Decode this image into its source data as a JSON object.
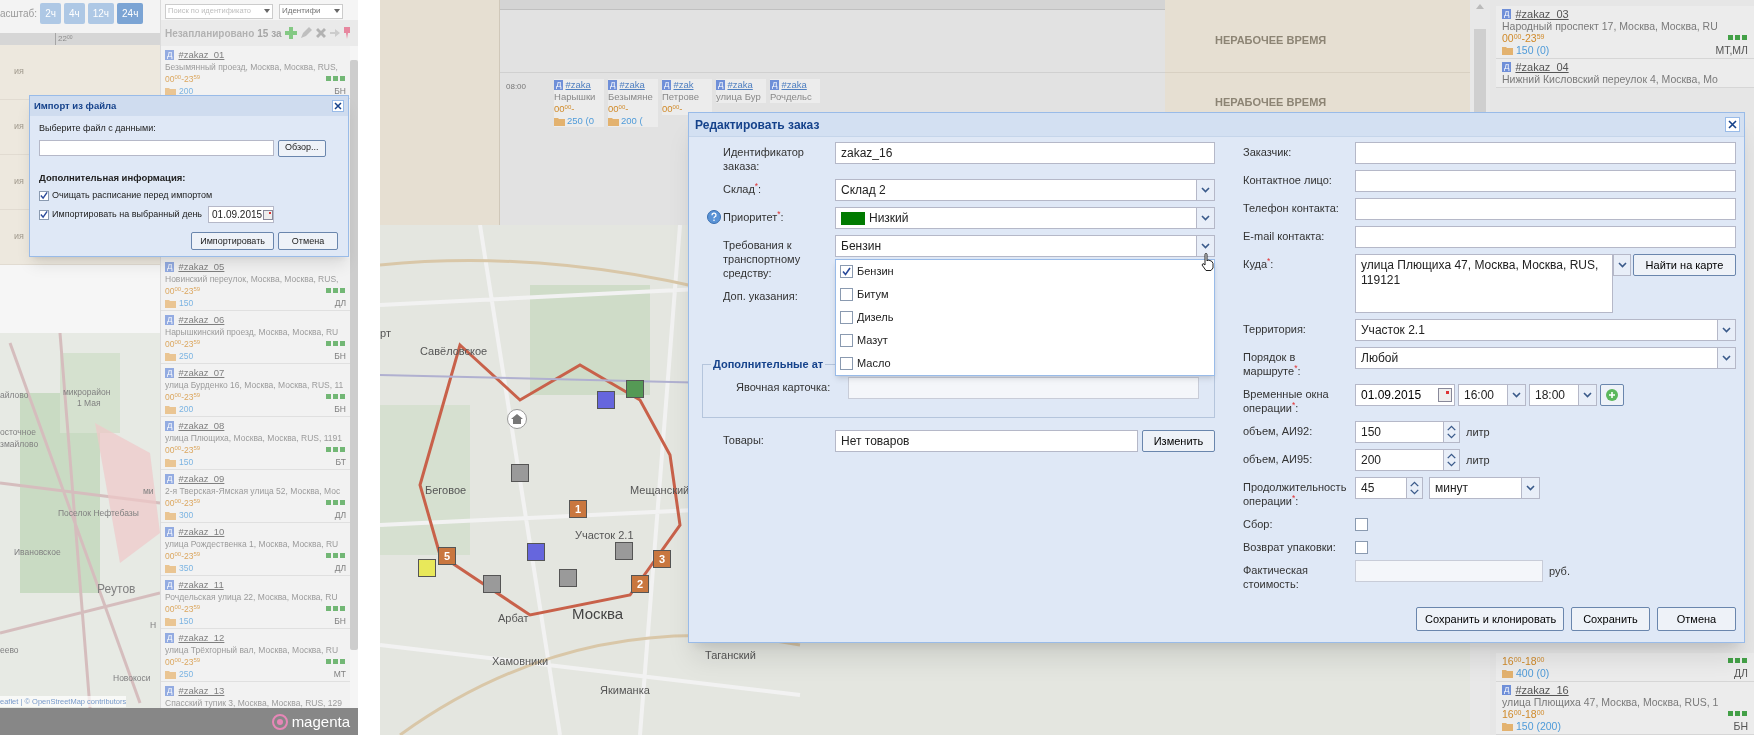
{
  "left_screen": {
    "scale_label": "асштаб:",
    "scale_options": [
      {
        "label": "2ч",
        "selected": false
      },
      {
        "label": "4ч",
        "selected": false
      },
      {
        "label": "12ч",
        "selected": false
      },
      {
        "label": "24ч",
        "selected": true
      }
    ],
    "search": {
      "placeholder": "Поиск по идентификато"
    },
    "search_by": "Идентифи",
    "timeline_hour": "22$^{00}$",
    "nonworking_rows": [
      "ия",
      "ия",
      "ия",
      "ия"
    ],
    "unplanned": {
      "label": "Незапланировано",
      "count": "15 за"
    },
    "orders_top": [
      {
        "badge": "Д",
        "id": "#zakaz_01",
        "address": "Безымянный проезд, Москва, Москва, RUS,",
        "time": "00$^{00}$-23$^{59}$",
        "volume": "200",
        "tag": "БН"
      }
    ],
    "orders_bottom": [
      {
        "badge": "Д",
        "id": "#zakaz_05",
        "address": "Новинский переулок, Москва, Москва, RUS,",
        "time": "00$^{00}$-23$^{59}$",
        "volume": "150",
        "tag": "ДЛ"
      },
      {
        "badge": "Д",
        "id": "#zakaz_06",
        "address": "Нарышкинский проезд, Москва, Москва, RU",
        "time": "00$^{00}$-23$^{59}$",
        "volume": "250",
        "tag": "БН"
      },
      {
        "badge": "Д",
        "id": "#zakaz_07",
        "address": "улица Бурденко 16, Москва, Москва, RUS, 11",
        "time": "00$^{00}$-23$^{59}$",
        "volume": "200",
        "tag": "БН"
      },
      {
        "badge": "Д",
        "id": "#zakaz_08",
        "address": "улица Плющиха, Москва, Москва, RUS, 1191",
        "time": "00$^{00}$-23$^{59}$",
        "volume": "150",
        "tag": "БТ"
      },
      {
        "badge": "Д",
        "id": "#zakaz_09",
        "address": "2-я Тверская-Ямская улица 52, Москва, Мос",
        "time": "00$^{00}$-23$^{59}$",
        "volume": "300",
        "tag": "ДЛ"
      },
      {
        "badge": "Д",
        "id": "#zakaz_10",
        "address": "улица Рождественка 1, Москва, Москва, RU",
        "time": "00$^{00}$-23$^{59}$",
        "volume": "350",
        "tag": "ДЛ"
      },
      {
        "badge": "Д",
        "id": "#zakaz_11",
        "address": "Рочдельская улица 22, Москва, Москва, RU",
        "time": "00$^{00}$-23$^{59}$",
        "volume": "150",
        "tag": "БН"
      },
      {
        "badge": "Д",
        "id": "#zakaz_12",
        "address": "улица Трёхгорный вал, Москва, Москва, RU",
        "time": "00$^{00}$-23$^{59}$",
        "volume": "250",
        "tag": "МТ"
      },
      {
        "badge": "Д",
        "id": "#zakaz_13",
        "address": "Спасский тупик 3, Москва, Москва, RUS, 129"
      }
    ],
    "map_labels": [
      "айлово",
      "микрорайон",
      "1 Мая",
      "осточное",
      "змайлово",
      "ми",
      "Поселок Нефтебазы",
      "Ивановское",
      "Реутов",
      "Н",
      "еево",
      "Новокоси"
    ],
    "attribution": "eaflet | © OpenStreetMap contributors",
    "logo": "magenta",
    "import_dialog": {
      "title": "Импорт из файла",
      "file_label": "Выберите файл с данными:",
      "browse": "Обзор...",
      "extra_title": "Дополнительная информация:",
      "options": [
        {
          "label": "Очищать расписание перед импортом",
          "checked": true
        },
        {
          "label": "Импортировать на выбранный день",
          "checked": true
        }
      ],
      "date": "01.09.2015",
      "buttons": [
        "Импортировать",
        "Отмена"
      ]
    }
  },
  "right_screen": {
    "timeline": {
      "nonworking": [
        "НЕРАБОЧЕЕ ВРЕМЯ",
        "НЕРАБОЧЕЕ ВРЕМЯ"
      ],
      "start_time": "08:00",
      "chips": [
        {
          "badge": "Д",
          "id": "#zaka",
          "address": "Нарышки",
          "time": "00$^{00}$-",
          "volume": "250 (0"
        },
        {
          "badge": "Д",
          "id": "#zaka",
          "address": "Безымяне",
          "time": "00$^{00}$-",
          "volume": "200 ("
        },
        {
          "badge": "Д",
          "id": "#zak",
          "address": "Петрове",
          "time": "00$^{00}$-"
        },
        {
          "badge": "Д",
          "id": "#zaka",
          "address": "улица Бур"
        },
        {
          "badge": "Д",
          "id": "#zaka",
          "address": "Рочдельс"
        }
      ]
    },
    "map": {
      "labels": [
        "рт",
        "Савёловское",
        "Беговое",
        "Мещанский",
        "Участок 2.1",
        "Арбат",
        "Москва",
        "Таганский",
        "Хамовники",
        "Якиманка"
      ],
      "markers": [
        {
          "color": "#6666dd"
        },
        {
          "color": "#559955"
        },
        {
          "color": "#9a9a9a"
        },
        {
          "color": "#c9773f",
          "number": "1"
        },
        {
          "color": "#9a9a9a"
        },
        {
          "color": "#6666dd"
        },
        {
          "color": "#e8e85a"
        },
        {
          "color": "#c9773f",
          "number": "5"
        },
        {
          "color": "#9a9a9a"
        },
        {
          "color": "#9a9a9a"
        },
        {
          "color": "#c9773f",
          "number": "3"
        },
        {
          "color": "#c9773f",
          "number": "2"
        }
      ]
    },
    "list_top": [
      {
        "badge": "Д",
        "id": "#zakaz_03",
        "address": "Народный проспект 17, Москва, Москва, RU",
        "time": "00$^{00}$-23$^{59}$",
        "volume": "150 (0)",
        "tag": "МТ,МЛ"
      },
      {
        "badge": "Д",
        "id": "#zakaz_04",
        "address": "Нижний Кисловский переулок 4, Москва, Мо"
      }
    ],
    "list_bottom": [
      {
        "time": "16$^{00}$-18$^{00}$",
        "volume": "400 (0)",
        "tag": "ДЛ"
      },
      {
        "badge": "Д",
        "id": "#zakaz_16",
        "address": "улица Плющиха 47, Москва, Москва, RUS, 1",
        "time": "16$^{00}$-18$^{00}$",
        "volume": "150 (200)",
        "tag": "БН"
      }
    ],
    "edit_dialog": {
      "title": "Редактировать заказ",
      "left_fields": [
        {
          "kind": "text",
          "label": "Идентификатор заказа:",
          "value": "zakaz_16"
        },
        {
          "kind": "select",
          "label": "Склад$^{*}$:",
          "value": "Склад 2"
        },
        {
          "kind": "select",
          "label": "Приоритет$^{*}$:",
          "value": "Низкий",
          "color": "#007a00",
          "help": true
        },
        {
          "kind": "multiselect",
          "label": "Требования к транспортному средству:",
          "value": "Бензин",
          "options": [
            {
              "label": "Бензин",
              "checked": true
            },
            {
              "label": "Битум",
              "checked": false
            },
            {
              "label": "Дизель",
              "checked": false
            },
            {
              "label": "Мазут",
              "checked": false
            },
            {
              "label": "Масло",
              "checked": false
            }
          ]
        },
        {
          "kind": "textarea",
          "label": "Доп. указания:"
        }
      ],
      "fieldset": {
        "legend": "Дополнительные ат",
        "label": "Явочная карточка:"
      },
      "goods": {
        "label": "Товары:",
        "value": "Нет товаров",
        "button": "Изменить"
      },
      "right_fields": [
        {
          "kind": "text",
          "label": "Заказчик:"
        },
        {
          "kind": "text",
          "label": "Контактное лицо:"
        },
        {
          "kind": "text",
          "label": "Телефон контакта:"
        },
        {
          "kind": "text",
          "label": "E-mail контакта:"
        },
        {
          "kind": "address",
          "label": "Куда$^{*}$:",
          "value": "улица Плющиха 47, Москва, Москва, RUS, 119121",
          "button": "Найти на карте"
        },
        {
          "kind": "select",
          "label": "Территория:",
          "value": "Участок 2.1"
        },
        {
          "kind": "select",
          "label": "Порядок в маршруте$^{*}$:",
          "value": "Любой"
        },
        {
          "kind": "timewindow",
          "label": "Временные окна операции$^{*}$:",
          "date": "01.09.2015",
          "from": "16:00",
          "to": "18:00"
        },
        {
          "kind": "spinner",
          "label": "объем, АИ92:",
          "value": "150",
          "unit": "литр"
        },
        {
          "kind": "spinner",
          "label": "объем, АИ95:",
          "value": "200",
          "unit": "литр"
        },
        {
          "kind": "duration",
          "label": "Продолжительность операции$^{*}$:",
          "value": "45",
          "unit": "минут"
        },
        {
          "kind": "checkbox",
          "label": "Сбор:",
          "checked": false
        },
        {
          "kind": "checkbox",
          "label": "Возврат упаковки:",
          "checked": false
        },
        {
          "kind": "money",
          "label": "Фактическая стоимость:",
          "unit": "руб."
        }
      ],
      "buttons": [
        "Сохранить и клонировать",
        "Сохранить",
        "Отмена"
      ]
    }
  }
}
